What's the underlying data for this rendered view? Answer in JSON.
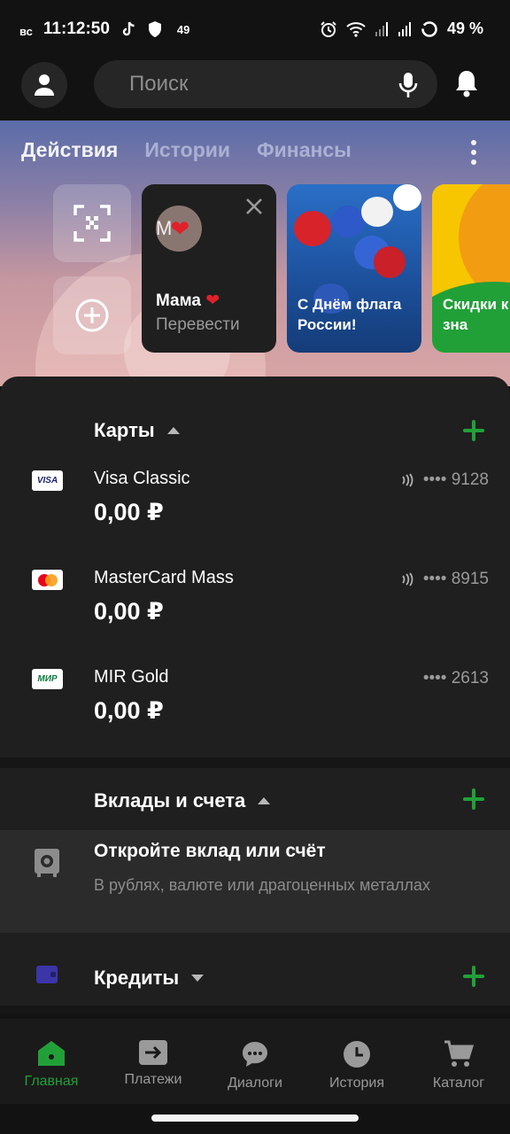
{
  "status_bar": {
    "day": "вс",
    "time": "11:12:50",
    "notif_count": "49",
    "battery": "49 %"
  },
  "search": {
    "placeholder": "Поиск"
  },
  "tabs": [
    {
      "label": "Действия",
      "active": true
    },
    {
      "label": "Истории",
      "active": false
    },
    {
      "label": "Финансы",
      "active": false
    }
  ],
  "stories": {
    "contact": {
      "avatar_letter": "М",
      "name": "Мама",
      "action": "Перевести"
    },
    "flag_day": {
      "title": "С Днём флага России!"
    },
    "sale": {
      "title": "Скидки к Дню зна"
    }
  },
  "cards_section": {
    "title": "Карты",
    "cards": [
      {
        "logo": "VISA",
        "name": "Visa Classic",
        "balance": "0,00 ₽",
        "number": "•••• 9128",
        "contactless": true
      },
      {
        "logo": "mastercard",
        "name": "MasterCard Mass",
        "balance": "0,00 ₽",
        "number": "•••• 8915",
        "contactless": true
      },
      {
        "logo": "МИР",
        "name": "MIR Gold",
        "balance": "0,00 ₽",
        "number": "•••• 2613",
        "contactless": false
      }
    ]
  },
  "deposits_section": {
    "title": "Вклады и счета",
    "promo_title": "Откройте вклад или счёт",
    "promo_subtitle": "В рублях, валюте или драгоценных металлах"
  },
  "credits_section": {
    "title": "Кредиты"
  },
  "bottom_nav": [
    {
      "label": "Главная",
      "icon": "home-icon",
      "active": true
    },
    {
      "label": "Платежи",
      "icon": "transfer-icon",
      "active": false
    },
    {
      "label": "Диалоги",
      "icon": "chat-icon",
      "active": false
    },
    {
      "label": "История",
      "icon": "clock-icon",
      "active": false
    },
    {
      "label": "Каталог",
      "icon": "cart-icon",
      "active": false
    }
  ],
  "colors": {
    "accent_green": "#21a038",
    "background": "#121212",
    "surface": "#1f1f1f"
  }
}
